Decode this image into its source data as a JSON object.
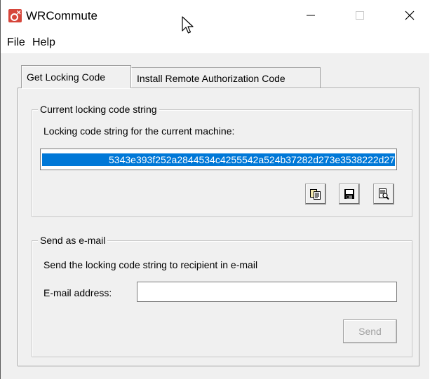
{
  "window": {
    "title": "WRCommute",
    "app_icon": "wrcommute-app-icon"
  },
  "menu": [
    {
      "label": "File"
    },
    {
      "label": "Help"
    }
  ],
  "tabs": [
    {
      "label": "Get Locking Code",
      "active": true
    },
    {
      "label": "Install Remote Authorization Code",
      "active": false
    }
  ],
  "locking_group": {
    "title": "Current locking code string",
    "description": "Locking code string for the current machine:",
    "code_value": "5343e393f252a2844534c4255542a524b37282d273e3538222d27",
    "buttons": [
      {
        "icon": "copy-icon"
      },
      {
        "icon": "save-disk-icon"
      },
      {
        "icon": "view-document-icon"
      }
    ]
  },
  "email_group": {
    "title": "Send as e-mail",
    "description": "Send the locking code string to recipient in e-mail",
    "address_label": "E-mail address:",
    "address_value": "",
    "send_label": "Send"
  },
  "colors": {
    "selection": "#0078d7",
    "dialog_bg": "#f0f0f0",
    "app_icon": "#d6463b"
  }
}
